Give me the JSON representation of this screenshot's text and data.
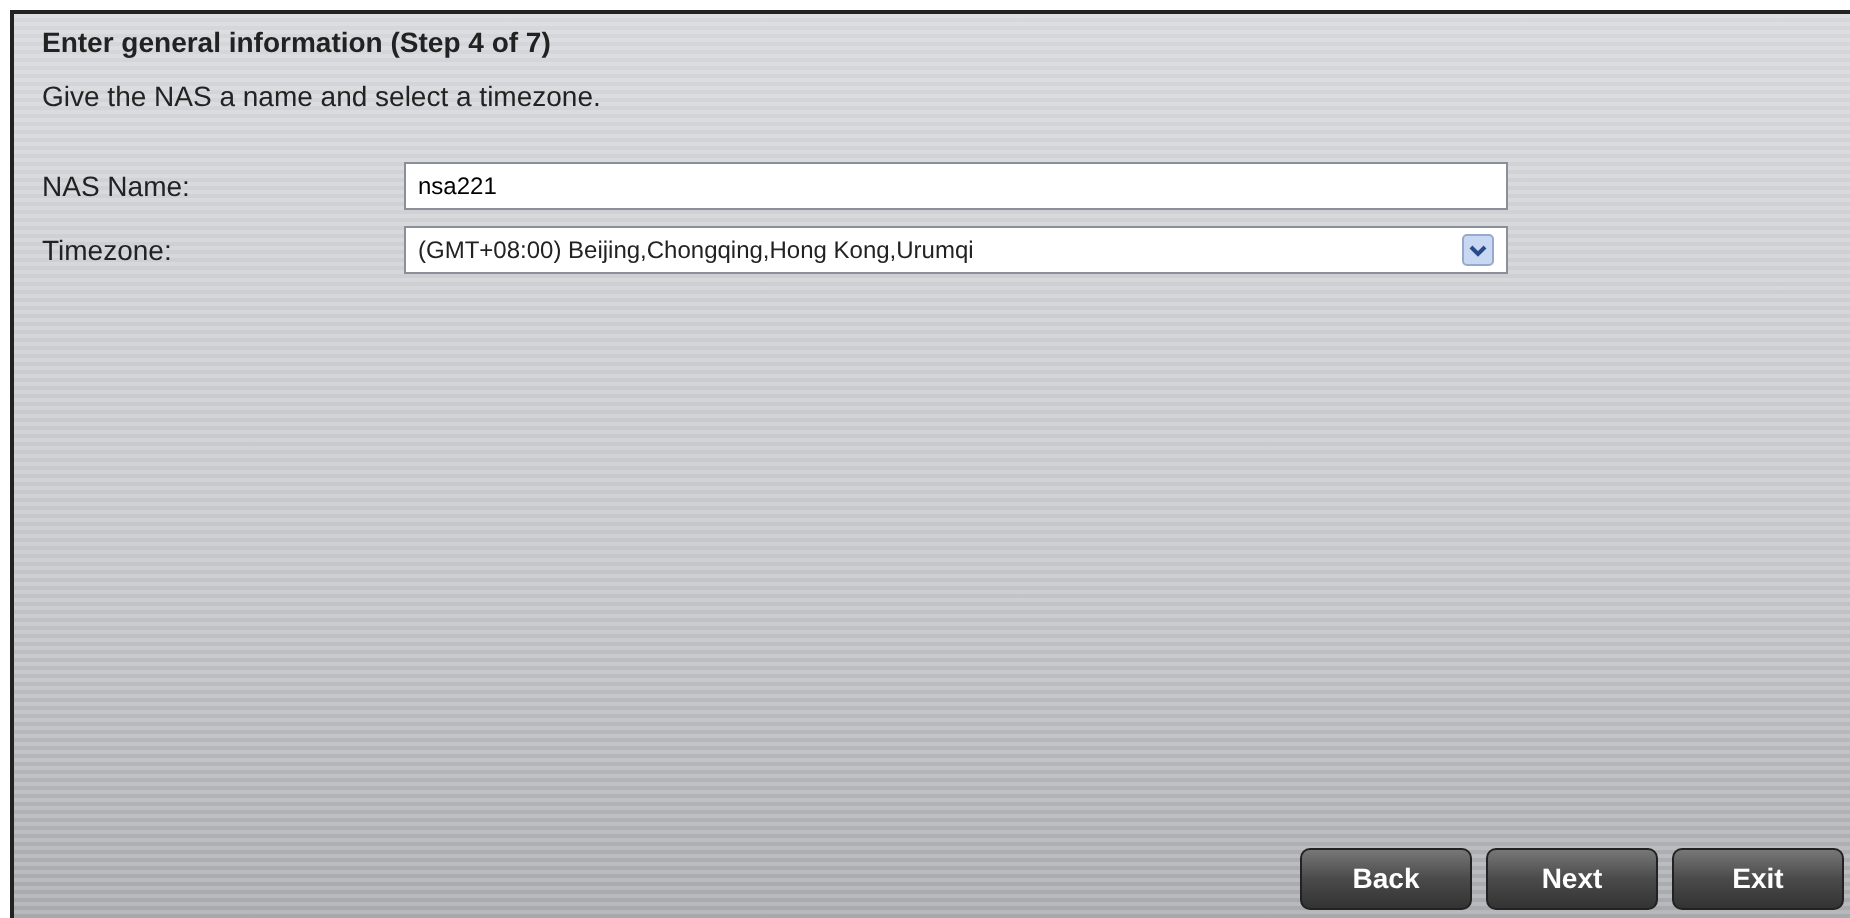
{
  "title": "Enter general information (Step 4 of 7)",
  "description": "Give the NAS a name and select a timezone.",
  "fields": [
    {
      "kind": "text",
      "label": "NAS Name:",
      "value": "nsa221"
    },
    {
      "kind": "select",
      "label": "Timezone:",
      "value": "(GMT+08:00) Beijing,Chongqing,Hong Kong,Urumqi"
    }
  ],
  "buttons": [
    "Back",
    "Next",
    "Exit"
  ]
}
